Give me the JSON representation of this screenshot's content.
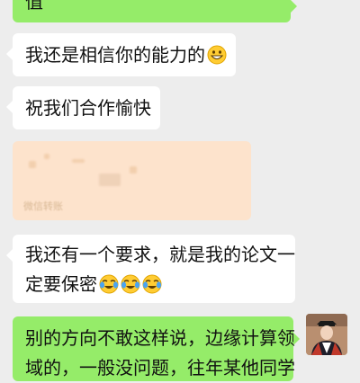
{
  "messages": [
    {
      "side": "right",
      "text": "值"
    },
    {
      "side": "left",
      "text": "我还是相信你的能力的",
      "emoji": "grin-emoji"
    },
    {
      "side": "left",
      "text": "祝我们合作愉快"
    },
    {
      "side": "left",
      "type": "card",
      "caption": "微信转账"
    },
    {
      "side": "left",
      "line1": "我还有一个要求，就是我的论文一",
      "line2": "定要保密",
      "emoji": "tears-of-joy-emoji x3"
    },
    {
      "side": "right",
      "line1": "别的方向不敢这样说，边缘计算领",
      "line2": "域的，一般没问题，往年某他同学"
    }
  ],
  "colors": {
    "sent": "#95ec69",
    "received": "#ffffff",
    "background": "#ededed",
    "card": "#fde3cc"
  }
}
